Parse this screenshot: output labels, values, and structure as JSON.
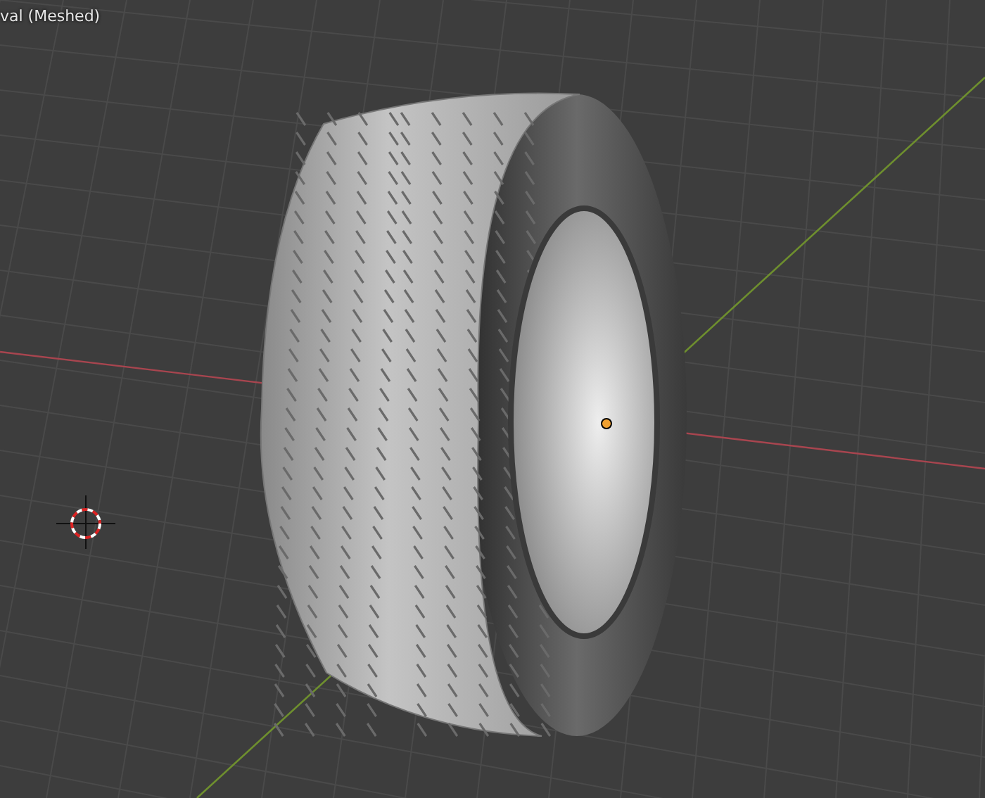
{
  "viewport": {
    "object_label": "val (Meshed)"
  }
}
